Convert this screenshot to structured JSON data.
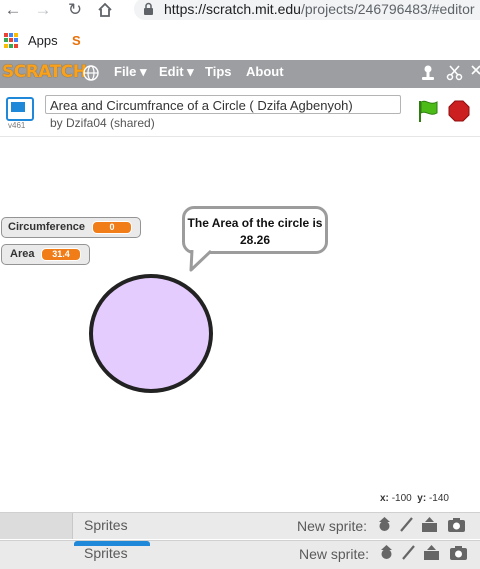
{
  "browser": {
    "url_main": "https://scratch.mit.edu",
    "url_rest": "/projects/246796483/#editor",
    "bookmark_apps": "Apps",
    "bookmark_s": "S"
  },
  "menubar": {
    "logo": "SCRATCH",
    "items": [
      "File ▾",
      "Edit ▾",
      "Tips",
      "About"
    ]
  },
  "project": {
    "version": "v461",
    "title": "Area and Circumfrance of a Circle ( Dzifa Agbenyoh)",
    "byline": "by Dzifa04 (shared)"
  },
  "monitors": [
    {
      "label": "Circumference",
      "value": "0"
    },
    {
      "label": "Area",
      "value": "31.4"
    }
  ],
  "sprite": {
    "speech": "The Area of the circle is 28.26",
    "fill_color": "#e5ccff"
  },
  "status": {
    "x_label": "x:",
    "x_value": "-100",
    "y_label": "y:",
    "y_value": "-140"
  },
  "sprites_pane": {
    "title": "Sprites",
    "new_sprite": "New sprite:"
  },
  "colors": {
    "menubar": "#9c9ea2",
    "logo": "#f9a11b",
    "monitor_value": "#f07d18",
    "green_flag": "#4cbb17",
    "stop": "#cc1f1f"
  }
}
